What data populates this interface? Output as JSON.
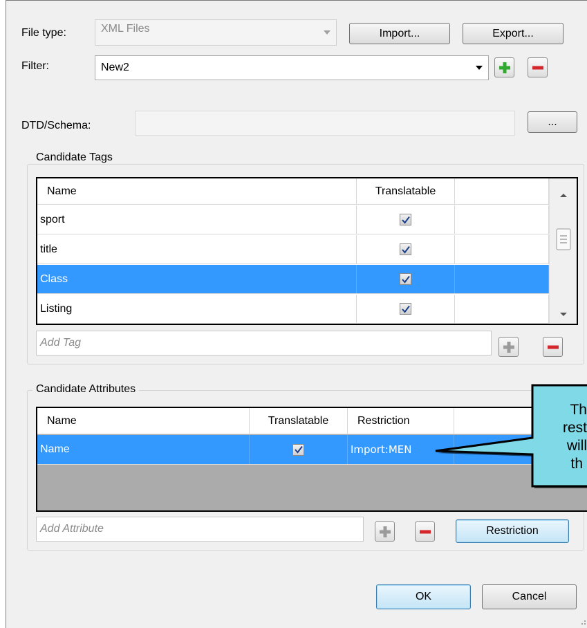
{
  "file_type": {
    "label": "File type:",
    "value": "XML Files"
  },
  "filter": {
    "label": "Filter:",
    "value": "New2"
  },
  "buttons": {
    "import": "Import...",
    "export": "Export...",
    "browse": "...",
    "restriction": "Restriction",
    "ok": "OK",
    "cancel": "Cancel"
  },
  "dtd": {
    "label": "DTD/Schema:",
    "value": ""
  },
  "candidate_tags": {
    "title": "Candidate Tags",
    "columns": [
      "Name",
      "Translatable"
    ],
    "rows": [
      {
        "name": "sport",
        "translatable": true
      },
      {
        "name": "title",
        "translatable": true
      },
      {
        "name": "Class",
        "translatable": true,
        "selected": true
      },
      {
        "name": "Listing",
        "translatable": true
      }
    ],
    "add_placeholder": "Add Tag"
  },
  "candidate_attributes": {
    "title": "Candidate Attributes",
    "columns": [
      "Name",
      "Translatable",
      "Restriction"
    ],
    "rows": [
      {
        "name": "Name",
        "translatable": true,
        "restriction": "Import:MEN",
        "selected": true
      }
    ],
    "add_placeholder": "Add Attribute"
  },
  "callout": {
    "lines": [
      "Th",
      "rest",
      "will",
      "th"
    ]
  },
  "icons": {
    "add": "plus-icon",
    "remove": "minus-icon",
    "check": "checkmark-icon"
  },
  "colors": {
    "selection": "#3399ff",
    "callout_fill": "#7fd9e6",
    "add_green": "#2faa2f",
    "remove_red": "#d4262b"
  }
}
